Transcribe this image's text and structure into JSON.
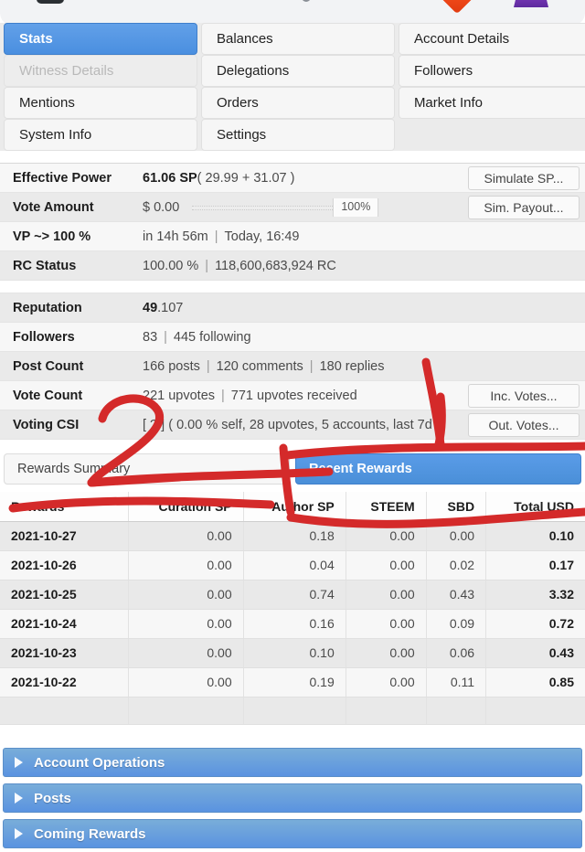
{
  "topbar": {
    "icons": [
      "card-icon",
      "dot-icon",
      "dash-icon",
      "diamond-icon",
      "purple-badge-icon"
    ]
  },
  "tabs": {
    "rows": [
      [
        {
          "label": "Stats",
          "state": "active"
        },
        {
          "label": "Balances",
          "state": "normal"
        },
        {
          "label": "Account Details",
          "state": "normal"
        }
      ],
      [
        {
          "label": "Witness Details",
          "state": "disabled"
        },
        {
          "label": "Delegations",
          "state": "normal"
        },
        {
          "label": "Followers",
          "state": "normal"
        }
      ],
      [
        {
          "label": "Mentions",
          "state": "normal"
        },
        {
          "label": "Orders",
          "state": "normal"
        },
        {
          "label": "Market Info",
          "state": "normal"
        }
      ],
      [
        {
          "label": "System Info",
          "state": "normal"
        },
        {
          "label": "Settings",
          "state": "normal"
        },
        {
          "label": "",
          "state": "blank"
        }
      ]
    ]
  },
  "stats": {
    "effective_power": {
      "label": "Effective Power",
      "value_bold": "61.06 SP",
      "value_rest": " ( 29.99 + 31.07 )",
      "button": "Simulate SP..."
    },
    "vote_amount": {
      "label": "Vote Amount",
      "value": "$ 0.00",
      "slider_percent": "100%",
      "button": "Sim. Payout..."
    },
    "vp": {
      "label": "VP ~> 100 %",
      "value_a": "in 14h 56m",
      "value_b": "Today, 16:49"
    },
    "rc_status": {
      "label": "RC Status",
      "value_a": "100.00 %",
      "value_b": "118,600,683,924 RC"
    },
    "reputation": {
      "label": "Reputation",
      "value_bold": "49",
      "value_rest": ".107"
    },
    "followers": {
      "label": "Followers",
      "value_a": "83",
      "value_b": "445 following"
    },
    "post_count": {
      "label": "Post Count",
      "value_a": "166 posts",
      "value_b": "120 comments",
      "value_c": "180 replies"
    },
    "vote_count": {
      "label": "Vote Count",
      "value_a": "221 upvotes",
      "value_b": "771 upvotes received",
      "button": "Inc. Votes..."
    },
    "voting_csi": {
      "label": "Voting CSI",
      "value": "[ ? ] ( 0.00 % self, 28 upvotes, 5 accounts, last 7d )",
      "button": "Out. Votes..."
    }
  },
  "rewards_tabs": [
    {
      "label": "Rewards Summary",
      "state": "normal"
    },
    {
      "label": "Recent Rewards",
      "state": "active"
    }
  ],
  "chart_data": {
    "type": "table",
    "title": "Recent Rewards",
    "columns": [
      "Rewards",
      "Curation SP",
      "Author SP",
      "STEEM",
      "SBD",
      "Total USD"
    ],
    "rows": [
      [
        "2021-10-27",
        "0.00",
        "0.18",
        "0.00",
        "0.00",
        "0.10"
      ],
      [
        "2021-10-26",
        "0.00",
        "0.04",
        "0.00",
        "0.02",
        "0.17"
      ],
      [
        "2021-10-25",
        "0.00",
        "0.74",
        "0.00",
        "0.43",
        "3.32"
      ],
      [
        "2021-10-24",
        "0.00",
        "0.16",
        "0.00",
        "0.09",
        "0.72"
      ],
      [
        "2021-10-23",
        "0.00",
        "0.10",
        "0.00",
        "0.06",
        "0.43"
      ],
      [
        "2021-10-22",
        "0.00",
        "0.19",
        "0.00",
        "0.11",
        "0.85"
      ]
    ],
    "empty_row": [
      "",
      "",
      "",
      "",
      "",
      ""
    ]
  },
  "accordions": [
    {
      "label": "Account Operations"
    },
    {
      "label": "Posts"
    },
    {
      "label": "Coming Rewards"
    }
  ],
  "colors": {
    "accent_blue": "#4a8fd8",
    "active_tab_blue": "#62a0e8",
    "annotation_red": "#d42a2a",
    "row_alt": "#e9e9e9",
    "row_norm": "#f7f7f7"
  }
}
